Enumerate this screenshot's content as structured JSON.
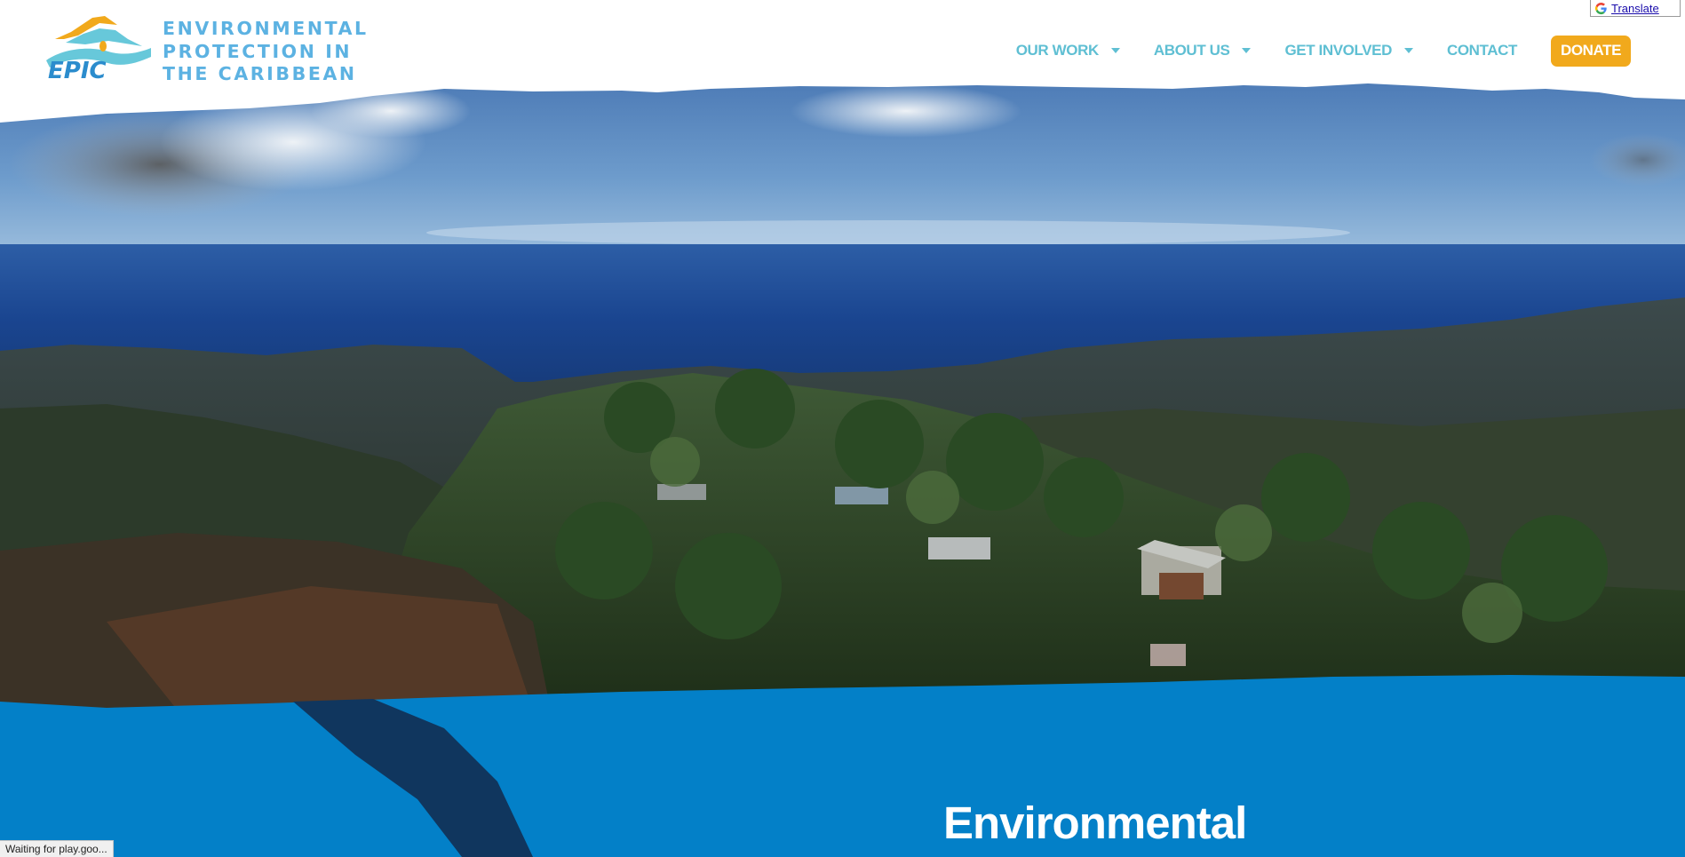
{
  "logo": {
    "icon": "epic-logo-icon",
    "line1": "ENVIRONMENTAL",
    "line2": "PROTECTION IN",
    "line3": "THE CARIBBEAN",
    "mark_text": "EPIC"
  },
  "nav": {
    "items": [
      {
        "label": "OUR WORK",
        "has_dropdown": true
      },
      {
        "label": "ABOUT US",
        "has_dropdown": true
      },
      {
        "label": "GET INVOLVED",
        "has_dropdown": true
      },
      {
        "label": "CONTACT",
        "has_dropdown": false
      }
    ],
    "donate_label": "DONATE"
  },
  "translate": {
    "label": "Translate",
    "icon": "google-g-icon"
  },
  "hero": {
    "image": "aerial mountain landscape over the sea",
    "heading": "Environmental"
  },
  "status_bar": {
    "text": "Waiting for play.goo..."
  },
  "colors": {
    "brand_blue": "#5cb2e2",
    "nav_teal": "#5fbfd3",
    "donate_orange": "#f1a91c",
    "band_blue": "#0380c8"
  }
}
